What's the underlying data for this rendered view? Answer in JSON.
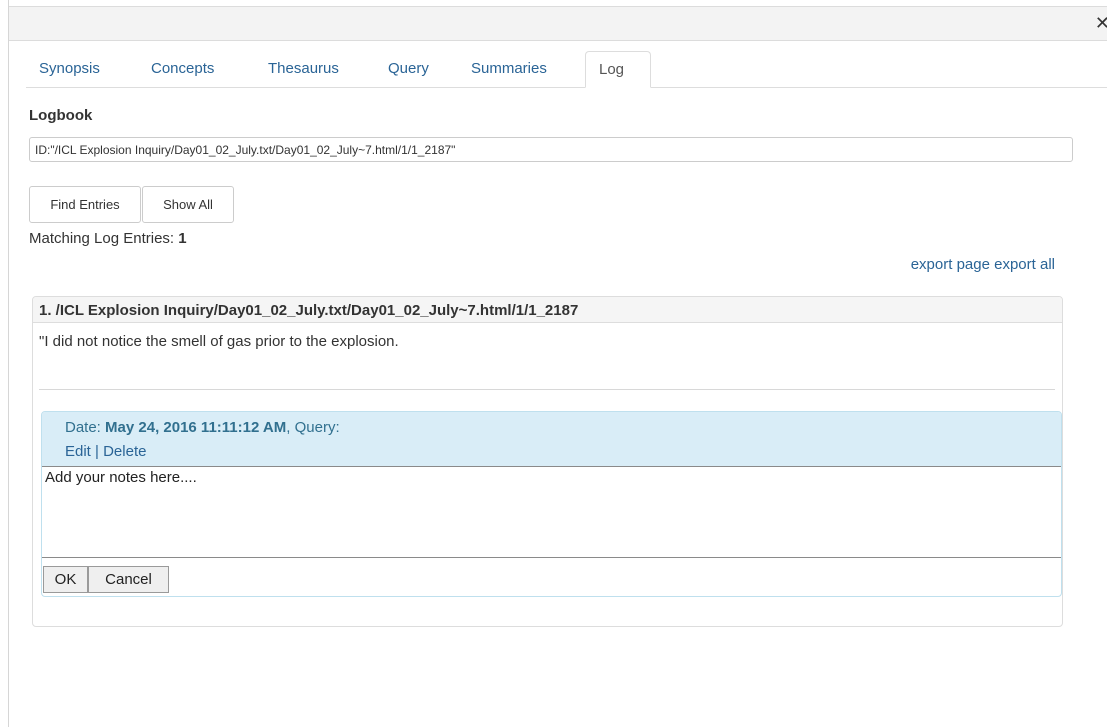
{
  "tabs": [
    {
      "label": "Synopsis"
    },
    {
      "label": "Concepts"
    },
    {
      "label": "Thesaurus"
    },
    {
      "label": "Query"
    },
    {
      "label": "Summaries"
    },
    {
      "label": "Log",
      "active": true
    }
  ],
  "close_icon": "close-icon",
  "logbook": {
    "title": "Logbook",
    "id_value": "ID:\"/ICL Explosion Inquiry/Day01_02_July.txt/Day01_02_July~7.html/1/1_2187\"",
    "find_button": "Find Entries",
    "show_all_button": "Show All",
    "matching_label": "Matching Log Entries: ",
    "matching_count": "1",
    "export_page": "export page",
    "export_all": "export all"
  },
  "entry": {
    "header": "1. /ICL Explosion Inquiry/Day01_02_July.txt/Day01_02_July~7.html/1/1_2187",
    "text": "\"I did not notice the smell of gas prior to the explosion.",
    "note": {
      "date_label": "Date: ",
      "date_value": "May 24, 2016 11:11:12 AM",
      "query_label": ", Query:",
      "edit": "Edit",
      "separator": " | ",
      "delete": "Delete",
      "textarea_value": "Add your notes here....",
      "ok_button": "OK",
      "cancel_button": "Cancel"
    }
  },
  "colors": {
    "link": "#2a6496",
    "note_header_bg": "#d9edf7",
    "note_border": "#bfe0ee"
  }
}
